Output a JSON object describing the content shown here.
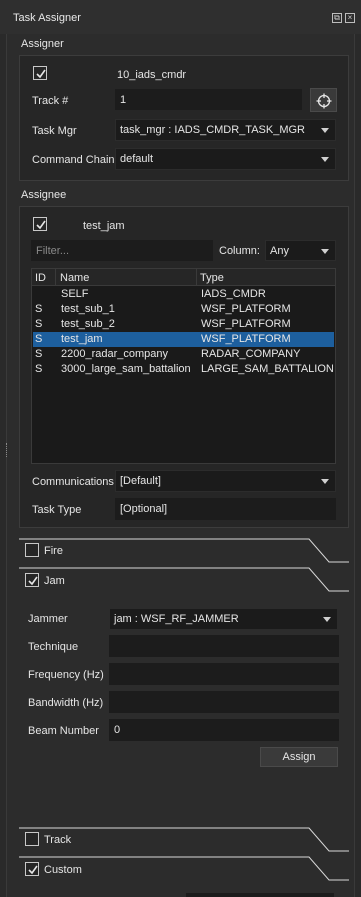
{
  "window": {
    "title": "Task Assigner"
  },
  "assigner": {
    "section_label": "Assigner",
    "platform_name": "10_iads_cmdr",
    "platform_checked": true,
    "track_label": "Track #",
    "track_value": "1",
    "task_mgr_label": "Task Mgr",
    "task_mgr_value": "task_mgr : IADS_CMDR_TASK_MGR",
    "command_chain_label": "Command Chain",
    "command_chain_value": "default"
  },
  "assignee": {
    "section_label": "Assignee",
    "platform_name": "test_jam",
    "platform_checked": true,
    "filter_placeholder": "Filter...",
    "column_label": "Column:",
    "column_value": "Any",
    "table": {
      "headers": [
        "ID",
        "Name",
        "Type"
      ],
      "rows": [
        {
          "id": "",
          "name": "SELF",
          "type": "IADS_CMDR",
          "selected": false
        },
        {
          "id": "S",
          "name": "test_sub_1",
          "type": "WSF_PLATFORM",
          "selected": false
        },
        {
          "id": "S",
          "name": "test_sub_2",
          "type": "WSF_PLATFORM",
          "selected": false
        },
        {
          "id": "S",
          "name": "test_jam",
          "type": "WSF_PLATFORM",
          "selected": true
        },
        {
          "id": "S",
          "name": "2200_radar_company",
          "type": "RADAR_COMPANY",
          "selected": false
        },
        {
          "id": "S",
          "name": "3000_large_sam_battalion",
          "type": "LARGE_SAM_BATTALION",
          "selected": false
        }
      ]
    },
    "communications_label": "Communications",
    "communications_value": "[Default]",
    "task_type_label": "Task Type",
    "task_type_value": "[Optional]"
  },
  "tasks": {
    "fire": {
      "label": "Fire",
      "checked": false
    },
    "jam": {
      "label": "Jam",
      "checked": true,
      "jammer_label": "Jammer",
      "jammer_value": "jam : WSF_RF_JAMMER",
      "technique_label": "Technique",
      "technique_value": "",
      "frequency_label": "Frequency (Hz)",
      "frequency_value": "",
      "bandwidth_label": "Bandwidth (Hz)",
      "bandwidth_value": "",
      "beam_label": "Beam Number",
      "beam_value": "0",
      "assign_label": "Assign"
    },
    "track": {
      "label": "Track",
      "checked": false
    },
    "custom": {
      "label": "Custom",
      "checked": true
    }
  },
  "icons": {
    "float": "float-icon",
    "close": "close-icon",
    "crosshair": "crosshair-icon",
    "check": "check-icon",
    "dropdown": "chevron-down-icon"
  },
  "colors": {
    "background": "#2c2c2c",
    "field": "#1c1c1c",
    "selection": "#1d5f9e",
    "text": "#e6e6e6"
  }
}
